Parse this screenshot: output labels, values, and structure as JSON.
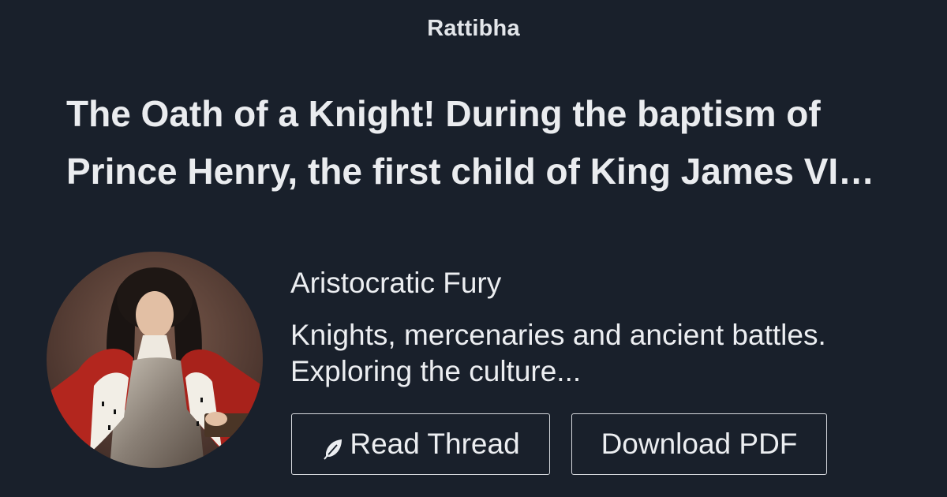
{
  "header": {
    "brand": "Rattibha"
  },
  "thread": {
    "title": "The Oath of a Knight! During the baptism of Prince Henry, the first child of King James VI…"
  },
  "author": {
    "name": "Aristocratic Fury",
    "bio_line1": "Knights, mercenaries and ancient battles.",
    "bio_line2": "Exploring the culture...",
    "avatar_icon": "knight-portrait"
  },
  "actions": {
    "read_label": "Read Thread",
    "read_icon": "feather-icon",
    "pdf_label": "Download PDF"
  },
  "colors": {
    "background": "#19202b",
    "text": "#eceef1",
    "button_border": "#d6d9de"
  }
}
